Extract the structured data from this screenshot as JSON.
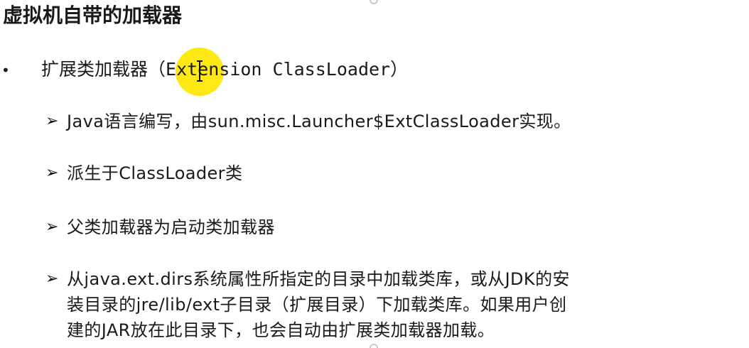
{
  "slide": {
    "title": "虚拟机自带的加载器",
    "bullet_symbol": "•",
    "item": {
      "label_cn": "扩展类加载器（",
      "label_en": "Extension ClassLoader",
      "label_close": "）"
    },
    "arrow_symbol": "➢",
    "sub_items": [
      {
        "parts": [
          "Java语言编写，由sun.misc.Launcher$ExtClassLoader实现。"
        ]
      },
      {
        "parts": [
          "派生于ClassLoader类"
        ]
      },
      {
        "parts": [
          "父类加载器为启动类加载器"
        ]
      },
      {
        "lines": [
          "从java.ext.dirs系统属性所指定的目录中加载类库，或从JDK的安",
          "装目录的jre/lib/ext子目录（扩展目录）下加载类库。如果用户创",
          "建的JAR放在此目录下，也会自动由扩展类加载器加载。"
        ]
      }
    ]
  },
  "cursor": {
    "highlight_color": "#ffe600",
    "type": "text-ibeam"
  }
}
